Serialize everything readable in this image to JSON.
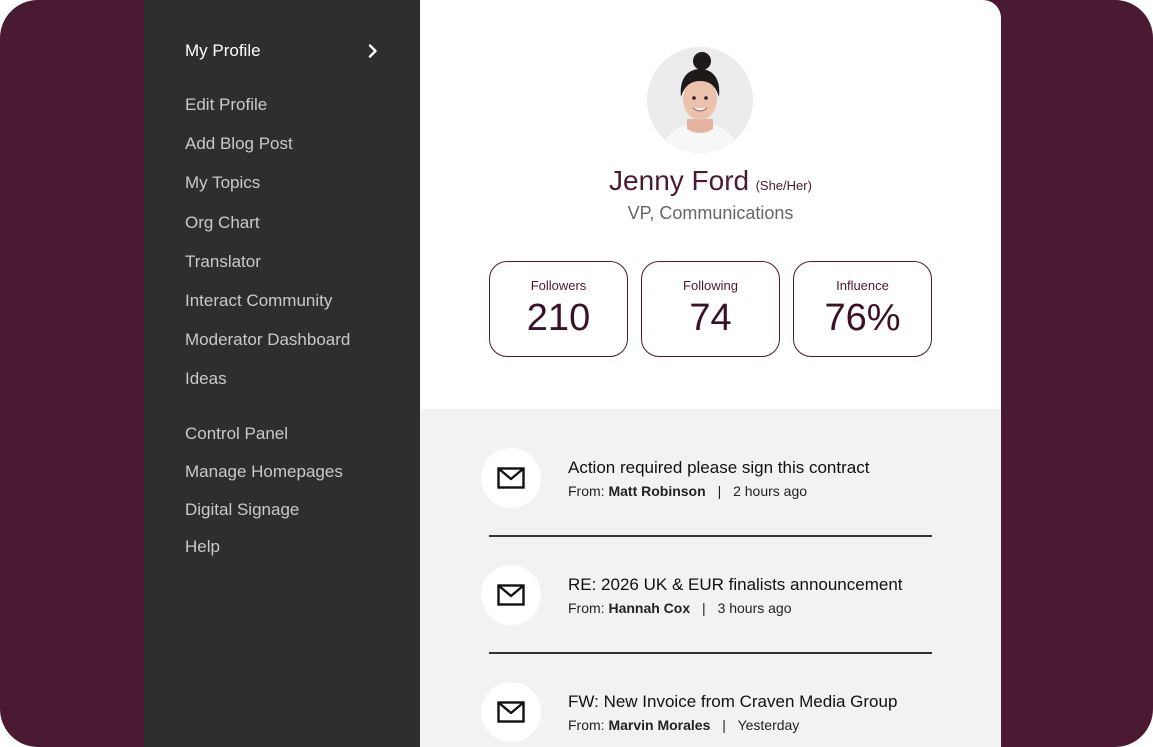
{
  "sidebar": {
    "header": "My Profile",
    "groups": [
      [
        "Edit Profile",
        "Add Blog Post",
        "My Topics",
        "Org Chart",
        "Translator",
        "Interact Community",
        "Moderator Dashboard",
        "Ideas"
      ],
      [
        "Control Panel",
        "Manage Homepages",
        "Digital Signage",
        "Help"
      ]
    ]
  },
  "profile": {
    "name": "Jenny Ford",
    "pronouns": "(She/Her)",
    "role": "VP, Communications",
    "stats": [
      {
        "label": "Followers",
        "value": "210"
      },
      {
        "label": "Following",
        "value": "74"
      },
      {
        "label": "Influence",
        "value": "76%"
      }
    ]
  },
  "messages": [
    {
      "subject": "Action required please sign this contract",
      "from_label": "From:",
      "from": "Matt Robinson",
      "separator": "|",
      "time": "2 hours ago",
      "icon": "mail-icon"
    },
    {
      "subject": "RE: 2026 UK & EUR finalists announcement",
      "from_label": "From:",
      "from": "Hannah Cox",
      "separator": "|",
      "time": "3 hours ago",
      "icon": "mail-icon"
    },
    {
      "subject": "FW: New Invoice from Craven Media Group",
      "from_label": "From:",
      "from": "Marvin Morales",
      "separator": "|",
      "time": "Yesterday",
      "icon": "mail-icon"
    }
  ],
  "colors": {
    "brand": "#4a1a33",
    "sidebar_bg": "#2e2e2e",
    "feed_bg": "#f2f2f2"
  }
}
